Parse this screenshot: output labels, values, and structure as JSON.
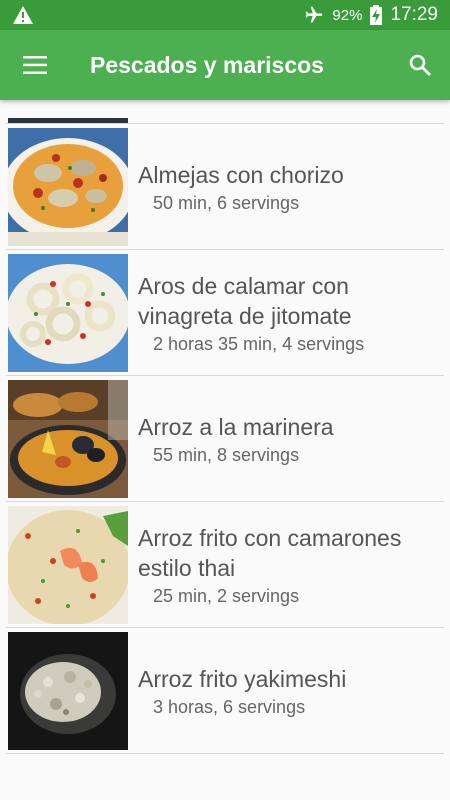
{
  "status_bar": {
    "battery": "92%",
    "time": "17:29",
    "icons": [
      "warning-icon",
      "airplane-mode-icon",
      "battery-charging-icon"
    ]
  },
  "app_bar": {
    "title": "Pescados y mariscos",
    "icons": [
      "menu-icon",
      "search-icon"
    ],
    "color": "#4caf50"
  },
  "recipes": [
    {
      "name": "Almejas con chorizo",
      "meta": "50 min, 6 servings"
    },
    {
      "name": "Aros de calamar con vinagreta de jitomate",
      "meta": "2 horas 35 min, 4 servings"
    },
    {
      "name": "Arroz a la marinera",
      "meta": "55 min, 8 servings"
    },
    {
      "name": "Arroz frito con camarones estilo thai",
      "meta": "25 min, 2 servings"
    },
    {
      "name": "Arroz frito yakimeshi",
      "meta": "3 horas, 6 servings"
    }
  ]
}
